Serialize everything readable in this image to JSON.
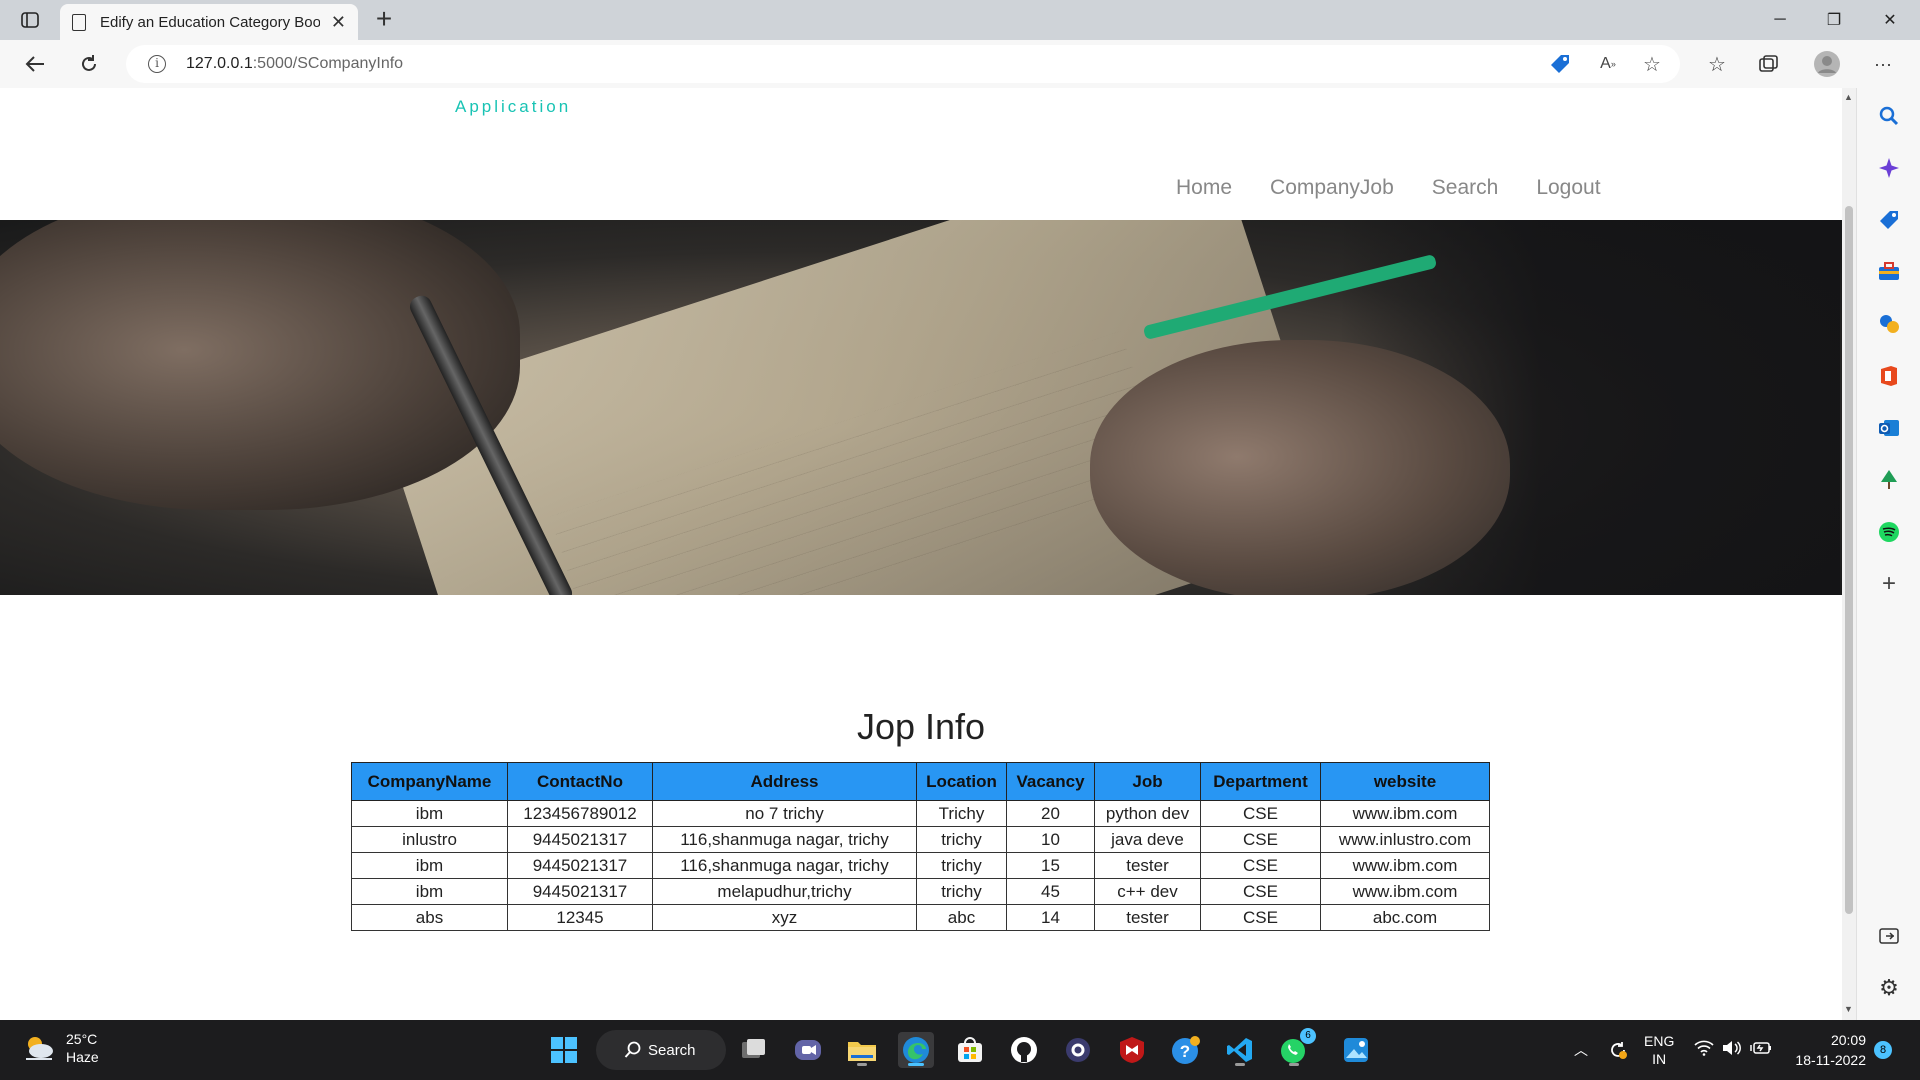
{
  "browser": {
    "tab_title": "Edify an Education Category Boo",
    "url_host": "127.0.0.1",
    "url_path": ":5000/SCompanyInfo"
  },
  "site": {
    "brand_subtitle": "Application",
    "nav": [
      "Home",
      "CompanyJob",
      "Search",
      "Logout"
    ]
  },
  "main": {
    "heading": "Jop Info",
    "table": {
      "columns": [
        "CompanyName",
        "ContactNo",
        "Address",
        "Location",
        "Vacancy",
        "Job",
        "Department",
        "website"
      ],
      "rows": [
        [
          "ibm",
          "123456789012",
          "no 7 trichy",
          "Trichy",
          "20",
          "python dev",
          "CSE",
          "www.ibm.com"
        ],
        [
          "inlustro",
          "9445021317",
          "116,shanmuga nagar, trichy",
          "trichy",
          "10",
          "java deve",
          "CSE",
          "www.inlustro.com"
        ],
        [
          "ibm",
          "9445021317",
          "116,shanmuga nagar, trichy",
          "trichy",
          "15",
          "tester",
          "CSE",
          "www.ibm.com"
        ],
        [
          "ibm",
          "9445021317",
          "melapudhur,trichy",
          "trichy",
          "45",
          "c++ dev",
          "CSE",
          "www.ibm.com"
        ],
        [
          "abs",
          "12345",
          "xyz",
          "abc",
          "14",
          "tester",
          "CSE",
          "abc.com"
        ]
      ]
    }
  },
  "taskbar": {
    "weather_temp": "25°C",
    "weather_desc": "Haze",
    "search_label": "Search",
    "lang": "ENG",
    "region": "IN",
    "time": "20:09",
    "date": "18-11-2022",
    "whatsapp_badge": "6",
    "notification_count": "8"
  },
  "colors": {
    "accent_teal": "#18c3b4",
    "table_header": "#2896f3"
  }
}
